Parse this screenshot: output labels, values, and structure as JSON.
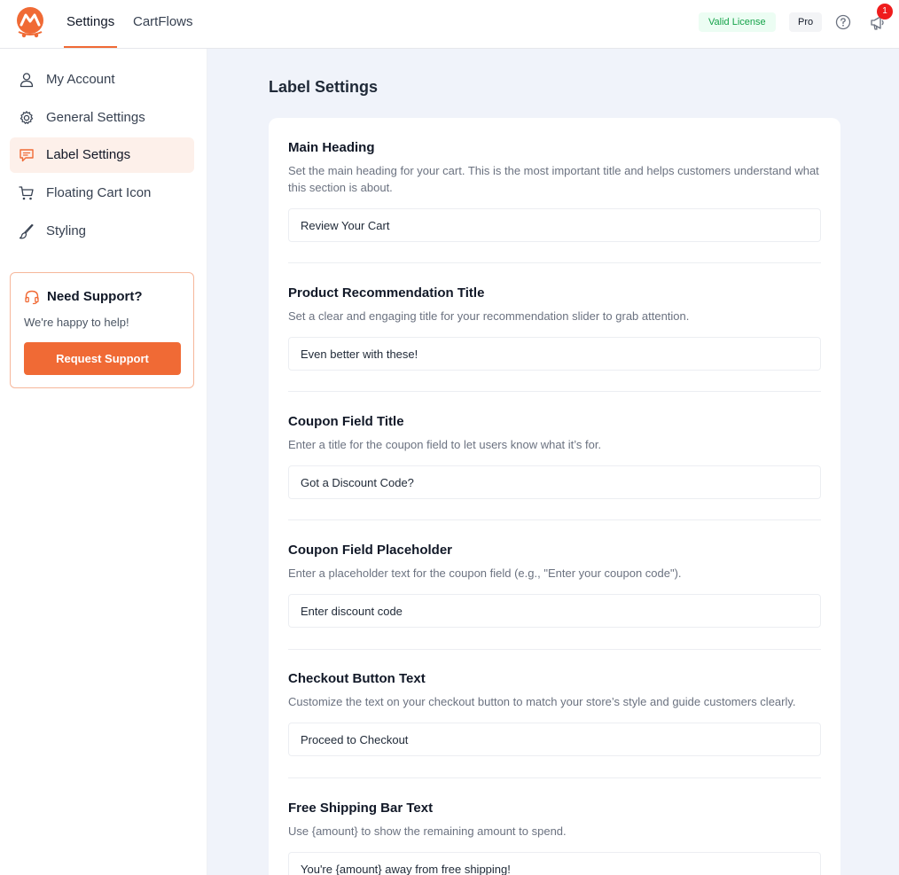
{
  "header": {
    "tabs": [
      {
        "label": "Settings",
        "active": true
      },
      {
        "label": "CartFlows",
        "active": false
      }
    ],
    "license_badge": "Valid License",
    "plan_badge": "Pro",
    "notification_count": "1",
    "accent_color": "#f06a35"
  },
  "sidebar": {
    "items": [
      {
        "label": "My Account",
        "icon": "user-icon",
        "active": false
      },
      {
        "label": "General Settings",
        "icon": "gear-icon",
        "active": false
      },
      {
        "label": "Label Settings",
        "icon": "chat-icon",
        "active": true
      },
      {
        "label": "Floating Cart Icon",
        "icon": "cart-icon",
        "active": false
      },
      {
        "label": "Styling",
        "icon": "brush-icon",
        "active": false
      }
    ],
    "support": {
      "title": "Need Support?",
      "subtitle": "We're happy to help!",
      "button": "Request Support"
    }
  },
  "main": {
    "title": "Label Settings",
    "fields": [
      {
        "title": "Main Heading",
        "description": "Set the main heading for your cart. This is the most important title and helps customers understand what this section is about.",
        "value": "Review Your Cart"
      },
      {
        "title": "Product Recommendation Title",
        "description": "Set a clear and engaging title for your recommendation slider to grab attention.",
        "value": "Even better with these!"
      },
      {
        "title": "Coupon Field Title",
        "description": "Enter a title for the coupon field to let users know what it’s for.",
        "value": "Got a Discount Code?"
      },
      {
        "title": "Coupon Field Placeholder",
        "description": "Enter a placeholder text for the coupon field (e.g., \"Enter your coupon code\").",
        "value": "Enter discount code"
      },
      {
        "title": "Checkout Button Text",
        "description": "Customize the text on your checkout button to match your store’s style and guide customers clearly.",
        "value": "Proceed to Checkout"
      },
      {
        "title": "Free Shipping Bar Text",
        "description": "Use {amount} to show the remaining amount to spend.",
        "value": "You're {amount} away from free shipping!"
      }
    ]
  }
}
